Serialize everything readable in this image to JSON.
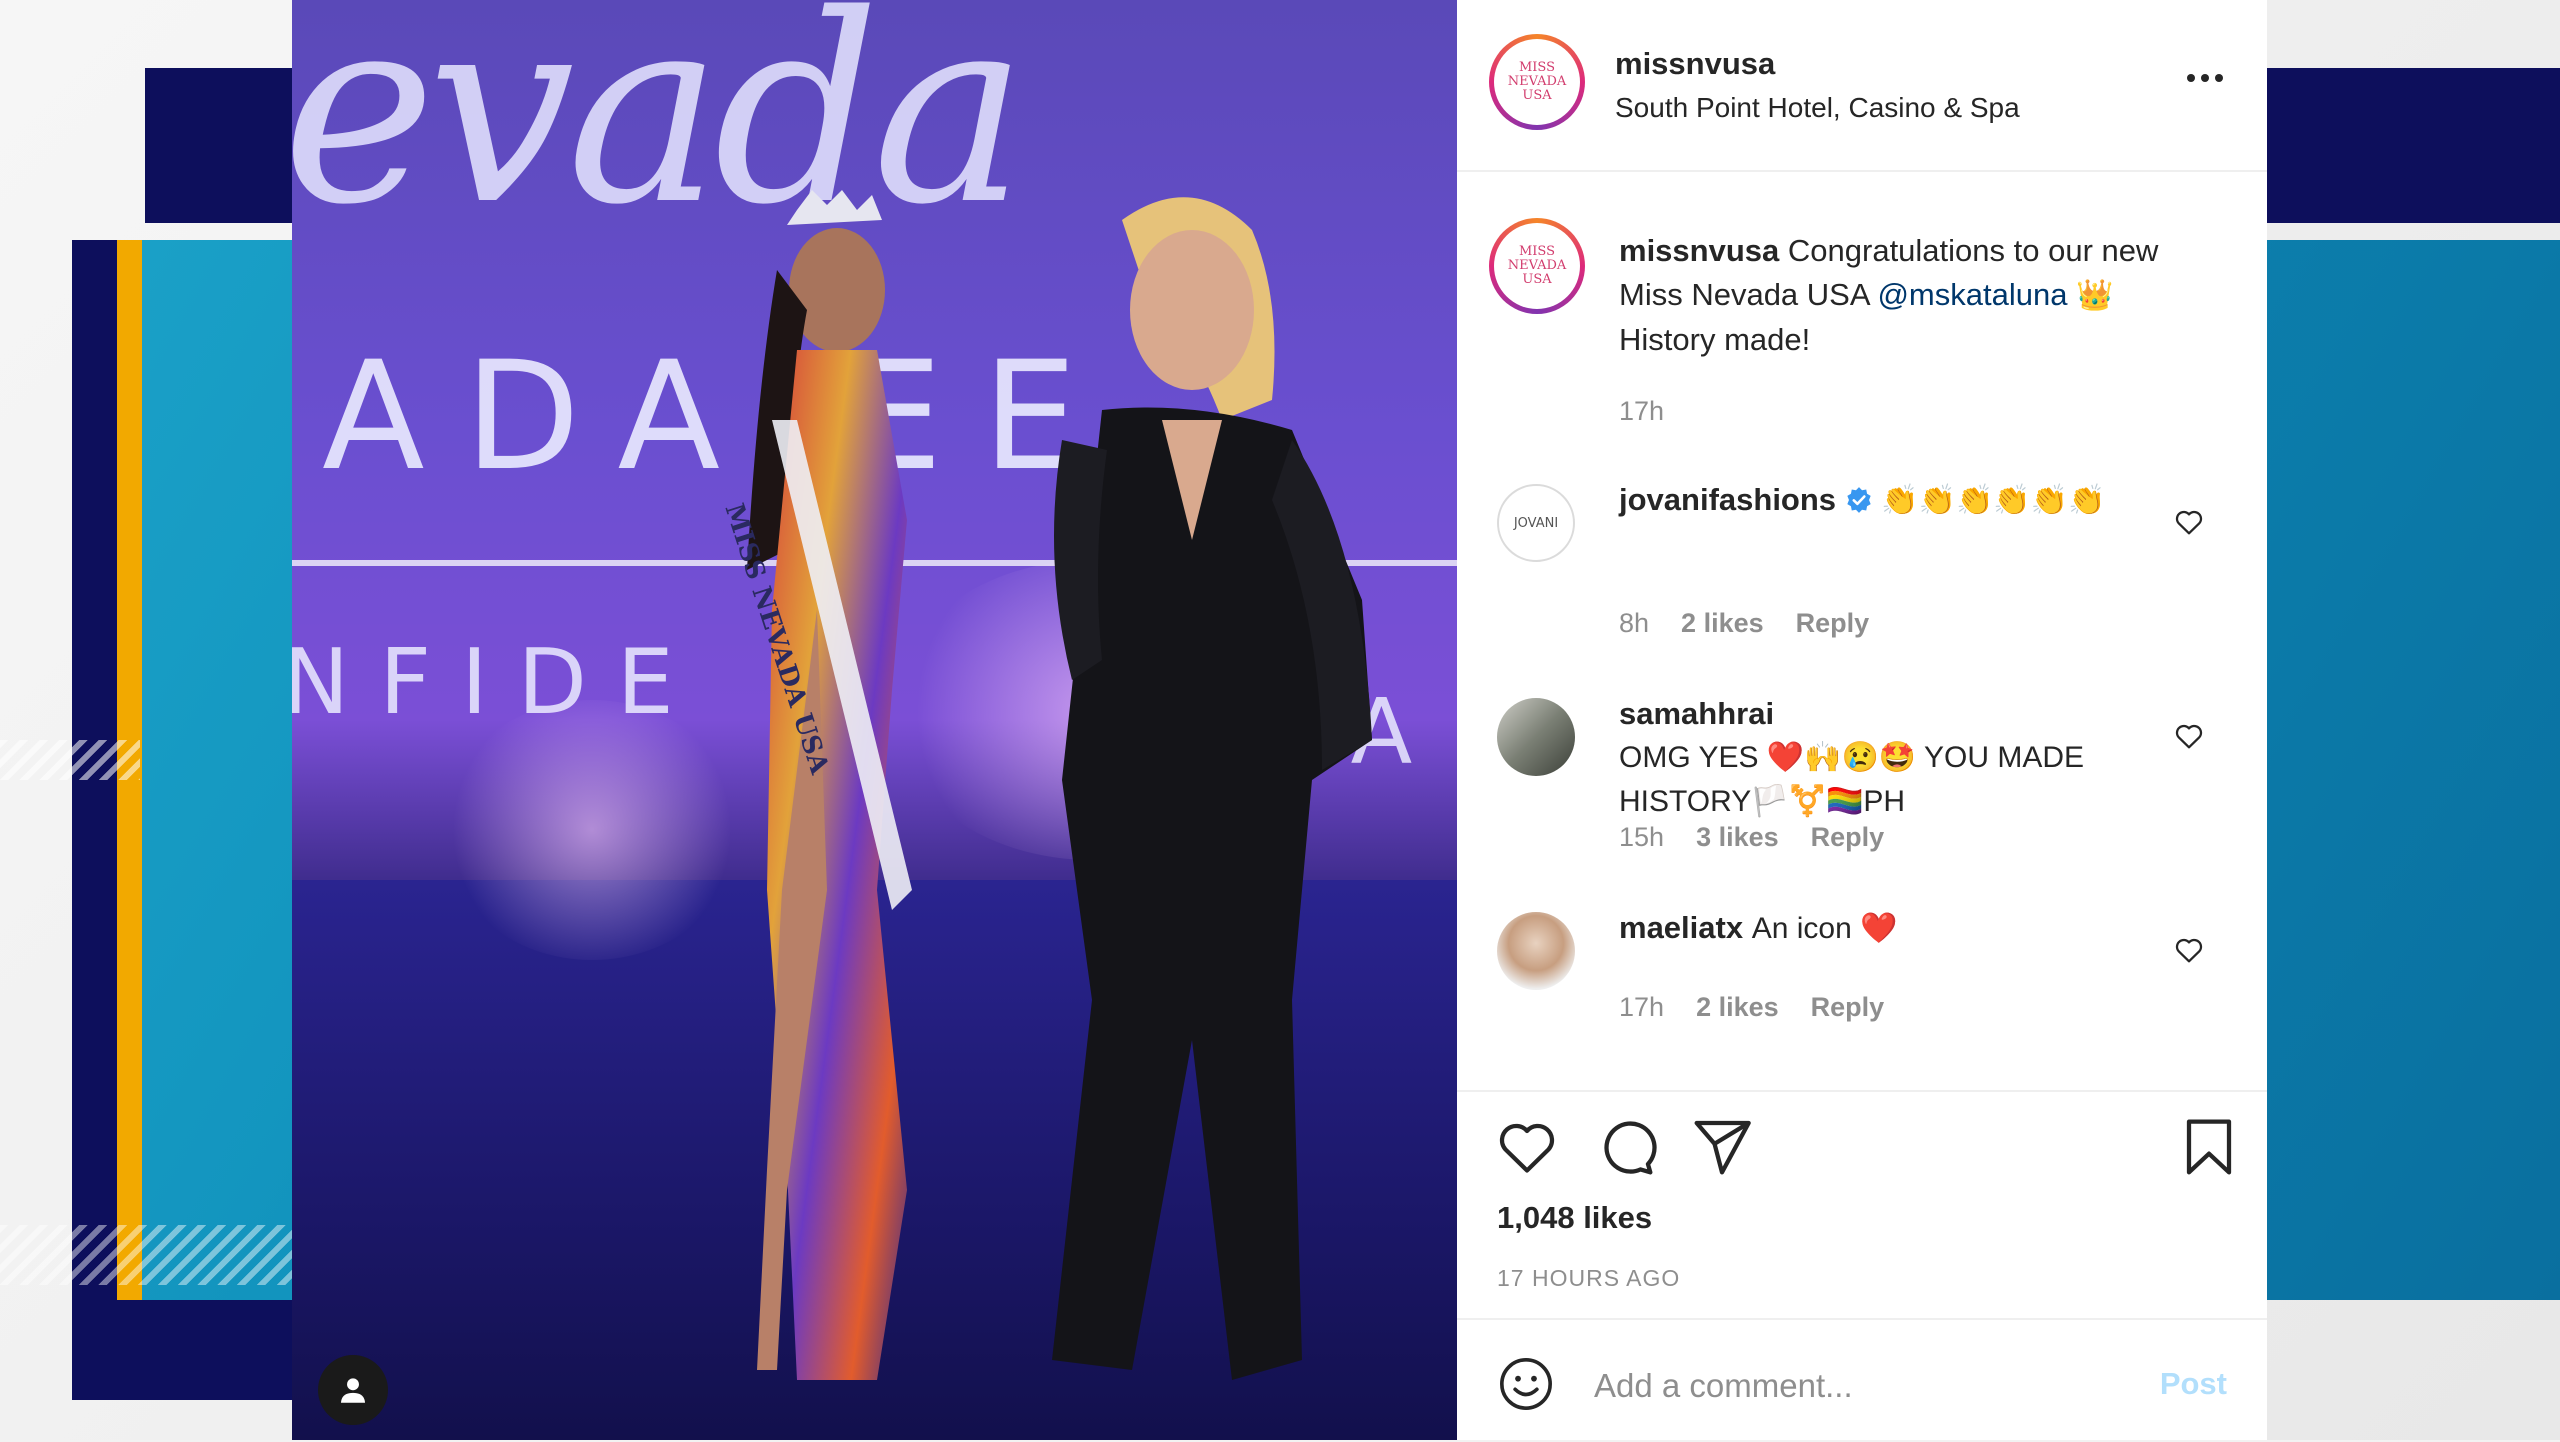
{
  "photo": {
    "script_text": "evada",
    "big_text": "ADA EE",
    "small_text": "NFIDE",
    "small_text2": "BEA",
    "sash_text": "MISS NEVADA USA"
  },
  "post": {
    "header": {
      "username": "missnvusa",
      "location": "South Point Hotel, Casino & Spa",
      "avatar_text": [
        "MISS",
        "NEVADA",
        "USA"
      ]
    },
    "caption": {
      "username": "missnvusa",
      "text": "Congratulations to our new Miss Nevada USA",
      "mention": "@mskataluna",
      "emoji": "👑",
      "text2": "History made!",
      "time": "17h"
    },
    "comments": [
      {
        "username": "jovanifashions",
        "verified": true,
        "text": "👏👏👏👏👏👏",
        "time": "8h",
        "likes": "2 likes",
        "reply": "Reply",
        "avatar_text": "JOVANI"
      },
      {
        "username": "samahhrai",
        "text": "OMG YES ❤️🙌😢🤩 YOU MADE HISTORY🏳️⚧️🏳️‍🌈PH",
        "time": "15h",
        "likes": "3 likes",
        "reply": "Reply"
      },
      {
        "username": "maeliatx",
        "text": "An icon ❤️",
        "time": "17h",
        "likes": "2 likes",
        "reply": "Reply"
      }
    ],
    "likes": "1,048 likes",
    "time_ago": "17 HOURS AGO",
    "add_comment_placeholder": "Add a comment...",
    "post_label": "Post"
  },
  "colors": {
    "navy": "#0d0f5c",
    "gold": "#f2a900",
    "teal": "#1aa0c7",
    "link": "#00376b",
    "verified": "#3897f0",
    "post_disabled": "#b2dffc"
  }
}
